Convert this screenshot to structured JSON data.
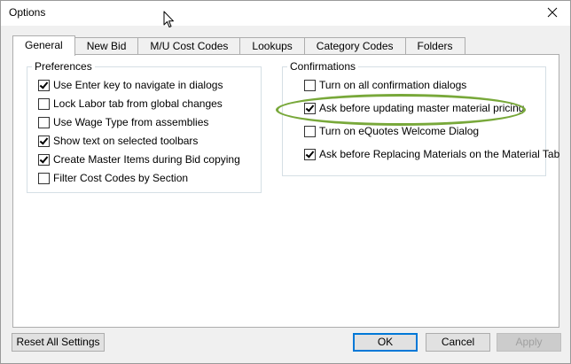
{
  "window": {
    "title": "Options"
  },
  "tabs": [
    {
      "label": "General",
      "active": true
    },
    {
      "label": "New Bid",
      "active": false
    },
    {
      "label": "M/U Cost Codes",
      "active": false
    },
    {
      "label": "Lookups",
      "active": false
    },
    {
      "label": "Category Codes",
      "active": false
    },
    {
      "label": "Folders",
      "active": false
    }
  ],
  "preferences": {
    "title": "Preferences",
    "items": [
      {
        "label": "Use Enter key to navigate in dialogs",
        "checked": true
      },
      {
        "label": "Lock Labor tab from global changes",
        "checked": false
      },
      {
        "label": "Use Wage Type from assemblies",
        "checked": false
      },
      {
        "label": "Show text on selected toolbars",
        "checked": true
      },
      {
        "label": "Create Master Items during Bid copying",
        "checked": true
      },
      {
        "label": "Filter Cost Codes by Section",
        "checked": false
      }
    ]
  },
  "confirmations": {
    "title": "Confirmations",
    "items": [
      {
        "label": "Turn on all confirmation dialogs",
        "checked": false
      },
      {
        "label": "Ask before updating master material pricing",
        "checked": true
      },
      {
        "label": "Turn on eQuotes Welcome Dialog",
        "checked": false
      },
      {
        "label": "Ask before Replacing Materials on the Material Tab",
        "checked": true
      }
    ]
  },
  "footer": {
    "reset_label": "Reset All Settings",
    "ok_label": "OK",
    "cancel_label": "Cancel",
    "apply_label": "Apply",
    "apply_enabled": false
  },
  "colors": {
    "highlight": "#78a83a",
    "default_button_border": "#0078d7"
  }
}
